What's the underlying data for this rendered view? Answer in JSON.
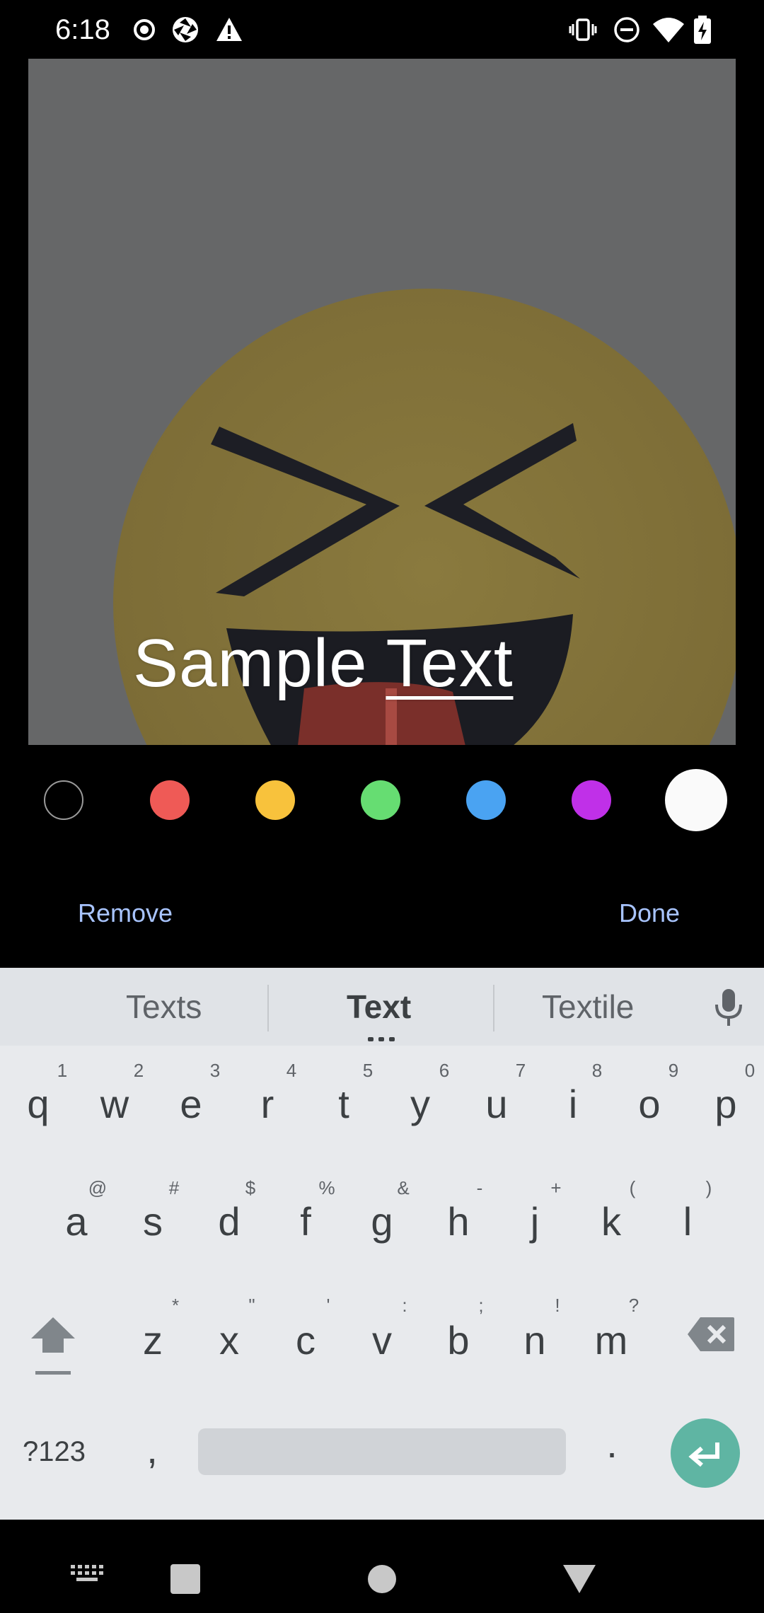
{
  "status_bar": {
    "time": "6:18",
    "left_icons": [
      "record-icon",
      "camera-shutter-icon",
      "warning-icon"
    ],
    "right_icons": [
      "vibrate-icon",
      "do-not-disturb-icon",
      "wifi-icon",
      "battery-charging-icon"
    ]
  },
  "editor": {
    "overlay_text_word1": "Sample",
    "overlay_text_word2": "Text"
  },
  "palette": {
    "colors": [
      "#000000",
      "#ef5a56",
      "#f8c23c",
      "#66dd72",
      "#4aa3f2",
      "#c030e8",
      "#fafafa"
    ],
    "selected_index": 6
  },
  "actions": {
    "remove_label": "Remove",
    "done_label": "Done"
  },
  "keyboard": {
    "suggestions": [
      "Texts",
      "Text",
      "Textile"
    ],
    "row1": [
      {
        "k": "q",
        "h": "1"
      },
      {
        "k": "w",
        "h": "2"
      },
      {
        "k": "e",
        "h": "3"
      },
      {
        "k": "r",
        "h": "4"
      },
      {
        "k": "t",
        "h": "5"
      },
      {
        "k": "y",
        "h": "6"
      },
      {
        "k": "u",
        "h": "7"
      },
      {
        "k": "i",
        "h": "8"
      },
      {
        "k": "o",
        "h": "9"
      },
      {
        "k": "p",
        "h": "0"
      }
    ],
    "row2": [
      {
        "k": "a",
        "h": "@"
      },
      {
        "k": "s",
        "h": "#"
      },
      {
        "k": "d",
        "h": "$"
      },
      {
        "k": "f",
        "h": "%"
      },
      {
        "k": "g",
        "h": "&"
      },
      {
        "k": "h",
        "h": "-"
      },
      {
        "k": "j",
        "h": "+"
      },
      {
        "k": "k",
        "h": "("
      },
      {
        "k": "l",
        "h": ")"
      }
    ],
    "row3": [
      {
        "k": "z",
        "h": "*"
      },
      {
        "k": "x",
        "h": "\""
      },
      {
        "k": "c",
        "h": "'"
      },
      {
        "k": "v",
        "h": ":"
      },
      {
        "k": "b",
        "h": ";"
      },
      {
        "k": "n",
        "h": "!"
      },
      {
        "k": "m",
        "h": "?"
      }
    ],
    "symbols_label": "?123",
    "comma": ",",
    "period": ".",
    "accent_color": "#5fb5a3"
  },
  "nav_bar": {
    "icons": [
      "keyboard-switch-icon",
      "recents-icon",
      "home-icon",
      "back-icon"
    ]
  }
}
